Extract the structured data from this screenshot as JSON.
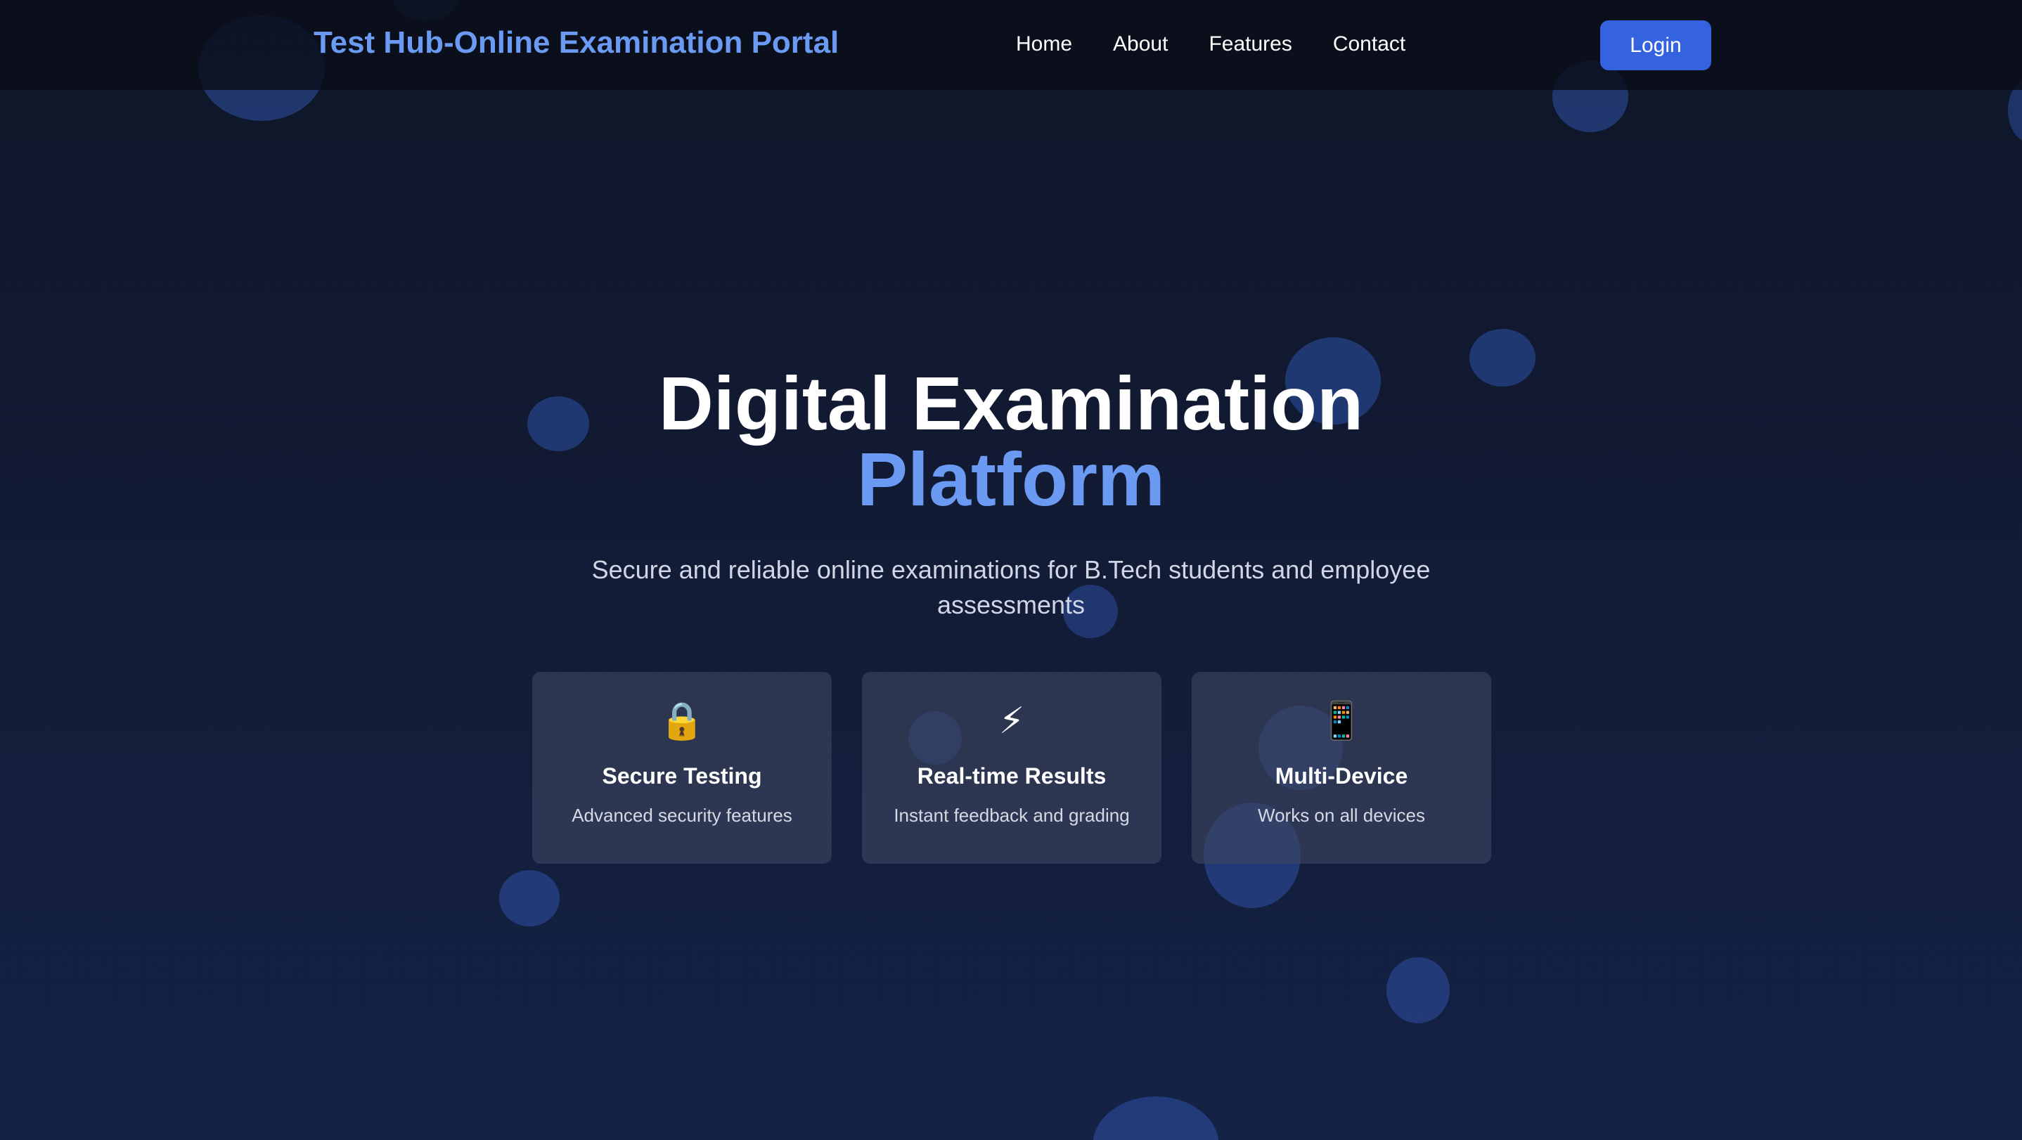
{
  "navbar": {
    "brand": "Test Hub-Online Examination Portal",
    "links": [
      "Home",
      "About",
      "Features",
      "Contact"
    ],
    "login_label": "Login"
  },
  "hero": {
    "title_line1": "Digital Examination",
    "title_line2": "Platform",
    "subtitle": "Secure and reliable online examinations for B.Tech students and employee assessments"
  },
  "features": [
    {
      "icon": "lock-icon",
      "glyph": "🔒",
      "title": "Secure Testing",
      "description": "Advanced security features"
    },
    {
      "icon": "lightning-icon",
      "glyph": "⚡",
      "title": "Real-time Results",
      "description": "Instant feedback and grading"
    },
    {
      "icon": "mobile-phone-icon",
      "glyph": "📱",
      "title": "Multi-Device",
      "description": "Works on all devices"
    }
  ],
  "colors": {
    "brand": "#6a9af2",
    "accent_button": "#3563e0",
    "background": "#121b34",
    "bubble": "#2b4d9c"
  }
}
